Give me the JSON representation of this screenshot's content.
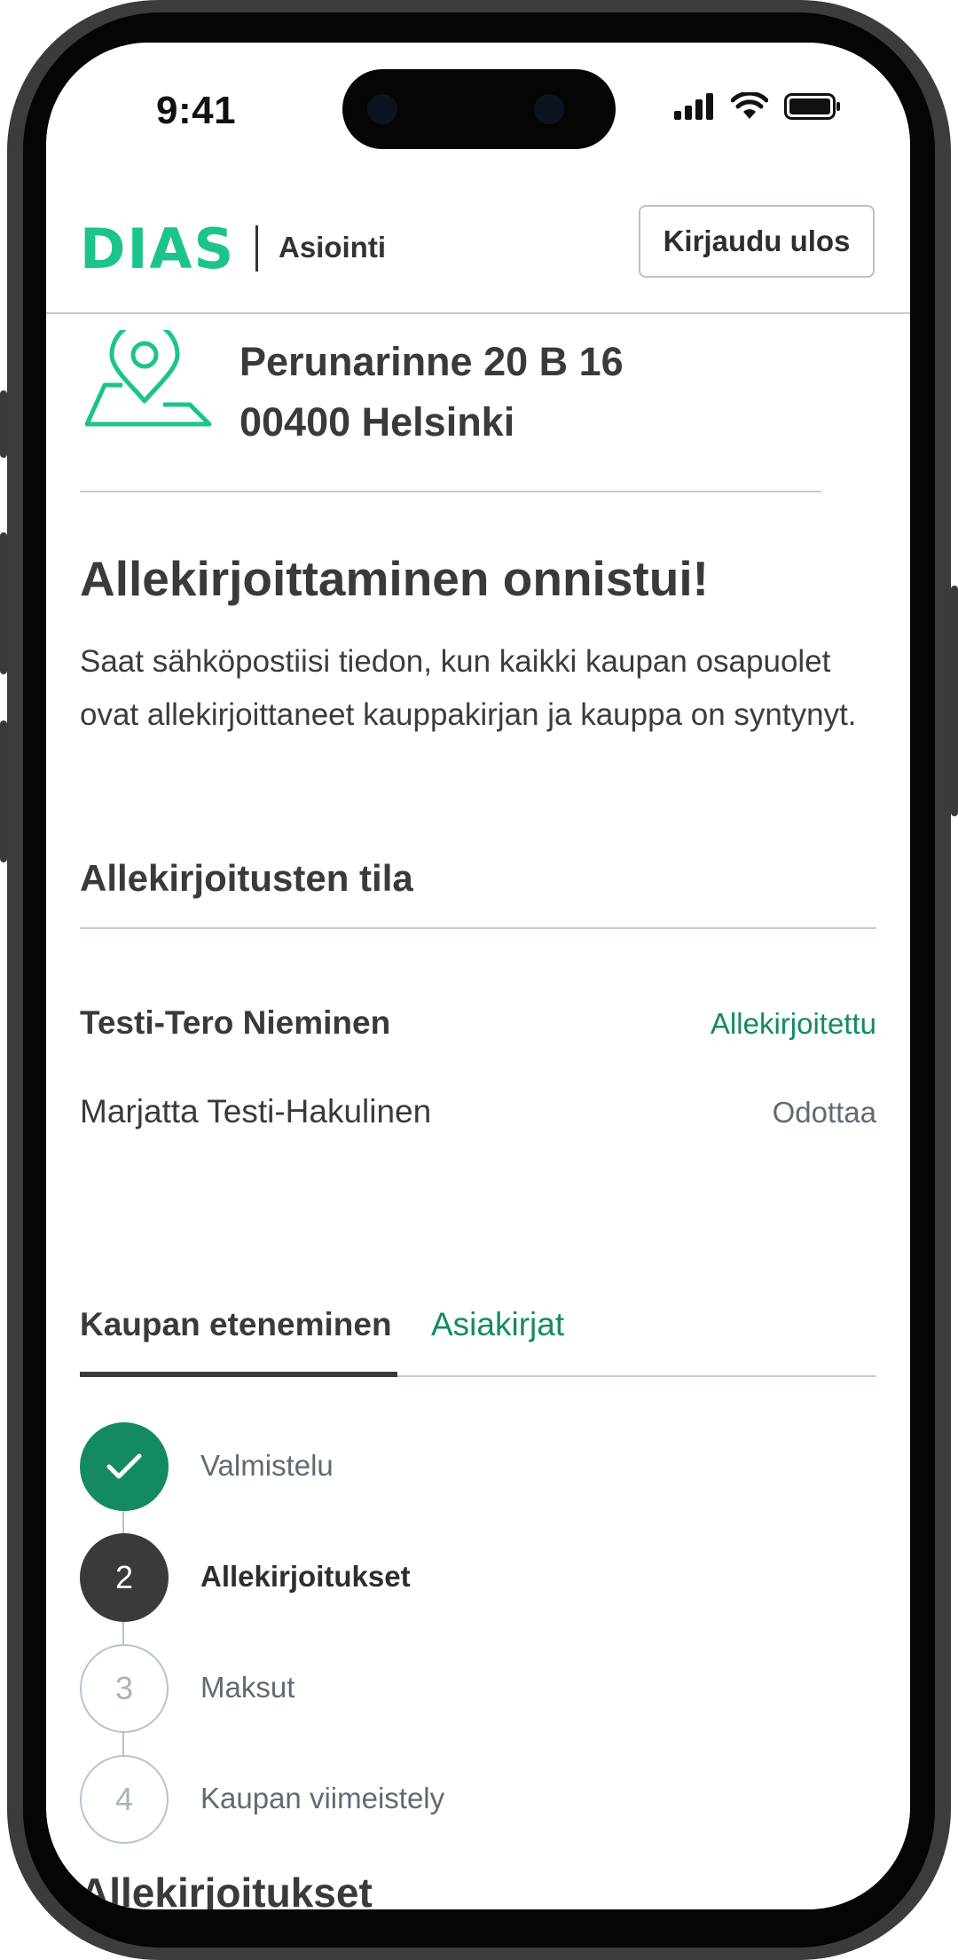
{
  "status_bar": {
    "time": "9:41"
  },
  "header": {
    "logo": "DIAS",
    "subtitle": "Asiointi",
    "logout_label": "Kirjaudu ulos"
  },
  "address": {
    "line1": "Perunarinne 20 B 16",
    "line2": "00400 Helsinki"
  },
  "success": {
    "title": "Allekirjoittaminen onnistui!",
    "description": "Saat sähköpostiisi tiedon, kun kaikki kaupan osapuolet ovat allekirjoittaneet kauppakirjan ja kauppa on syntynyt."
  },
  "signatures": {
    "heading": "Allekirjoitusten tila",
    "rows": [
      {
        "name": "Testi-Tero Nieminen",
        "status": "Allekirjoitettu"
      },
      {
        "name": "Marjatta Testi-Hakulinen",
        "status": "Odottaa"
      }
    ]
  },
  "tabs": [
    {
      "label": "Kaupan eteneminen"
    },
    {
      "label": "Asiakirjat"
    }
  ],
  "steps": [
    {
      "number": "",
      "label": "Valmistelu"
    },
    {
      "number": "2",
      "label": "Allekirjoitukset"
    },
    {
      "number": "3",
      "label": "Maksut"
    },
    {
      "number": "4",
      "label": "Kaupan viimeistely"
    }
  ],
  "next_section": {
    "heading": "Allekirjoitukset"
  },
  "colors": {
    "brand": "#1cc38c",
    "success_text": "#148a62",
    "step_done": "#148a62",
    "step_current": "#3a3a3a",
    "muted": "#5f6b73"
  },
  "icons": {
    "address": "map-pin-icon",
    "step_done": "check-icon"
  }
}
